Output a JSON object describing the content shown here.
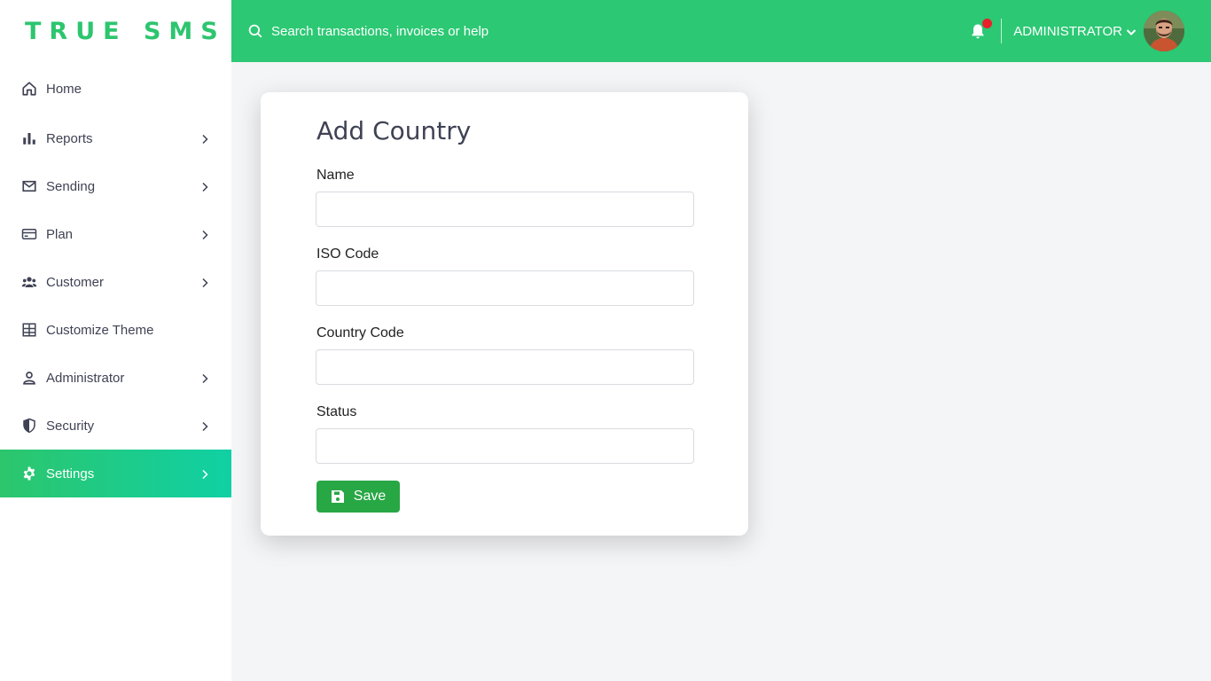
{
  "brand": {
    "logo_text": "TRUE SMS",
    "primary_color": "#2cc874",
    "active_gradient": [
      "#2cc66c",
      "#10d0a4"
    ]
  },
  "topbar": {
    "search_placeholder": "Search transactions, invoices or help",
    "user_name": "ADMINISTRATOR",
    "has_notification": true,
    "notification_dot_color": "#e8202a"
  },
  "sidebar": {
    "items": [
      {
        "label": "Home",
        "icon": "home-icon",
        "has_chevron": false,
        "active": false
      },
      {
        "label": "Reports",
        "icon": "bar-chart-icon",
        "has_chevron": true,
        "active": false
      },
      {
        "label": "Sending",
        "icon": "envelope-icon",
        "has_chevron": true,
        "active": false
      },
      {
        "label": "Plan",
        "icon": "credit-card-icon",
        "has_chevron": true,
        "active": false
      },
      {
        "label": "Customer",
        "icon": "users-icon",
        "has_chevron": true,
        "active": false
      },
      {
        "label": "Customize Theme",
        "icon": "grid-icon",
        "has_chevron": false,
        "active": false
      },
      {
        "label": "Administrator",
        "icon": "user-icon",
        "has_chevron": true,
        "active": false
      },
      {
        "label": "Security",
        "icon": "shield-icon",
        "has_chevron": true,
        "active": false
      },
      {
        "label": "Settings",
        "icon": "gear-icon",
        "has_chevron": true,
        "active": true
      }
    ]
  },
  "form": {
    "title": "Add Country",
    "fields": [
      {
        "label": "Name",
        "value": "",
        "placeholder": ""
      },
      {
        "label": "ISO Code",
        "value": "",
        "placeholder": ""
      },
      {
        "label": "Country Code",
        "value": "",
        "placeholder": ""
      },
      {
        "label": "Status",
        "value": "",
        "placeholder": ""
      }
    ],
    "save_label": "Save",
    "save_color": "#28a745"
  }
}
